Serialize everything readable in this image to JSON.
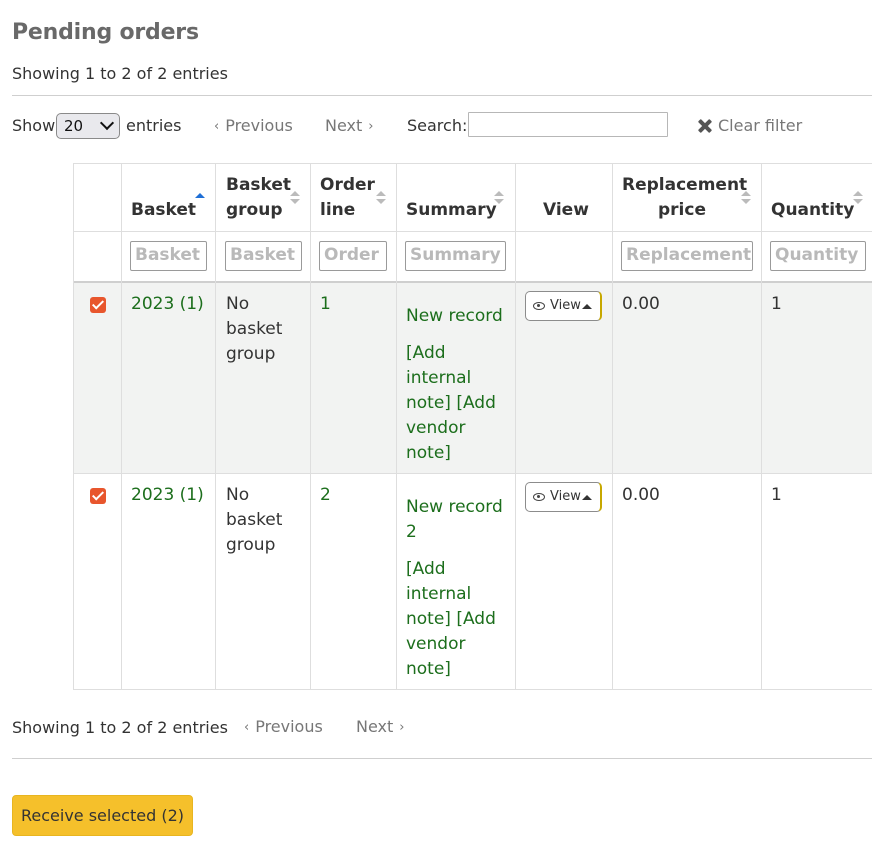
{
  "page": {
    "title": "Pending orders"
  },
  "info": {
    "top": "Showing 1 to 2 of 2 entries",
    "bottom": "Showing 1 to 2 of 2 entries"
  },
  "controls": {
    "show_label": "Show",
    "page_size": "20",
    "entries_label": "entries",
    "previous": "Previous",
    "next": "Next",
    "search_label": "Search:",
    "search_value": "",
    "clear_filter": "Clear filter"
  },
  "table": {
    "headers": {
      "basket": "Basket",
      "basket_group_1": "Basket",
      "basket_group_2": "group",
      "order_line_1": "Order",
      "order_line_2": "line",
      "summary": "Summary",
      "view": "View",
      "replacement_1": "Replacement",
      "replacement_2": "price",
      "quantity": "Quantity"
    },
    "filters": {
      "basket": "Basket s",
      "basket_group": "Basket g",
      "order_line": "Order l",
      "summary": "Summary s",
      "replacement": "Replacement p",
      "quantity": "Quantity s"
    },
    "rows": [
      {
        "checked": true,
        "basket": "2023 (1)",
        "basket_group": [
          "No",
          "basket",
          "group"
        ],
        "order_line": "1",
        "summary_title": [
          "New record"
        ],
        "notes": [
          "[Add",
          "internal",
          "note] [Add",
          "vendor",
          "note]"
        ],
        "view_label": "View",
        "replacement_price": "0.00",
        "quantity": "1"
      },
      {
        "checked": true,
        "basket": "2023 (1)",
        "basket_group": [
          "No",
          "basket",
          "group"
        ],
        "order_line": "2",
        "summary_title": [
          "New record",
          "2"
        ],
        "notes": [
          "[Add",
          "internal",
          "note] [Add",
          "vendor",
          "note]"
        ],
        "view_label": "View",
        "replacement_price": "0.00",
        "quantity": "1"
      }
    ]
  },
  "actions": {
    "receive_selected": "Receive selected (2)"
  },
  "colors": {
    "accent_button": "#f5c02b",
    "checkbox": "#e8562d",
    "link": "#1c6e1c",
    "sort_active": "#1f6fd6"
  }
}
